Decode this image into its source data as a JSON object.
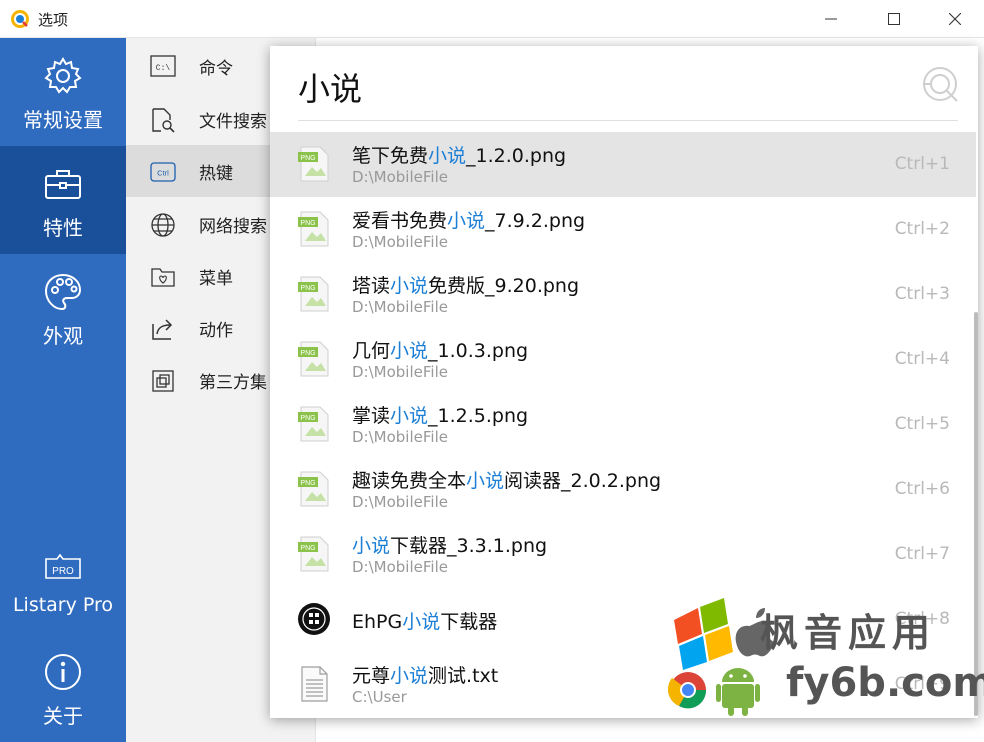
{
  "window": {
    "title": "选项",
    "controls": {
      "minimize": "minimize",
      "maximize": "maximize",
      "close": "close"
    }
  },
  "sidebar": {
    "items": [
      {
        "label": "常规设置",
        "icon": "gear-icon",
        "active": false
      },
      {
        "label": "特性",
        "icon": "toolbox-icon",
        "active": true
      },
      {
        "label": "外观",
        "icon": "palette-icon",
        "active": false
      },
      {
        "label": "Listary Pro",
        "icon": "pro-badge-icon",
        "active": false,
        "badge": "PRO"
      },
      {
        "label": "关于",
        "icon": "info-icon",
        "active": false
      }
    ]
  },
  "midlist": {
    "items": [
      {
        "label": "命令",
        "icon": "command-prompt-icon",
        "icon_text": "C:\\",
        "active": false
      },
      {
        "label": "文件搜索",
        "icon": "file-search-icon",
        "active": false
      },
      {
        "label": "热键",
        "icon": "hotkey-icon",
        "icon_text": "Ctrl",
        "active": true
      },
      {
        "label": "网络搜索",
        "icon": "globe-icon",
        "active": false
      },
      {
        "label": "菜单",
        "icon": "menu-folder-icon",
        "active": false
      },
      {
        "label": "动作",
        "icon": "action-share-icon",
        "active": false
      },
      {
        "label": "第三方集",
        "icon": "integration-icon",
        "active": false
      }
    ]
  },
  "search": {
    "query": "小说",
    "results": [
      {
        "pre": "笔下免费",
        "hl": "小说",
        "post": "_1.2.0.png",
        "path": "D:\\MobileFile",
        "key": "Ctrl+1",
        "type": "png",
        "badge": "PNG",
        "active": true
      },
      {
        "pre": "爱看书免费",
        "hl": "小说",
        "post": "_7.9.2.png",
        "path": "D:\\MobileFile",
        "key": "Ctrl+2",
        "type": "png",
        "badge": "PNG",
        "active": false
      },
      {
        "pre": "塔读",
        "hl": "小说",
        "post": "免费版_9.20.png",
        "path": "D:\\MobileFile",
        "key": "Ctrl+3",
        "type": "png",
        "badge": "PNG",
        "active": false
      },
      {
        "pre": "几何",
        "hl": "小说",
        "post": "_1.0.3.png",
        "path": "D:\\MobileFile",
        "key": "Ctrl+4",
        "type": "png",
        "badge": "PNG",
        "active": false
      },
      {
        "pre": "掌读",
        "hl": "小说",
        "post": "_1.2.5.png",
        "path": "D:\\MobileFile",
        "key": "Ctrl+5",
        "type": "png",
        "badge": "PNG",
        "active": false
      },
      {
        "pre": "趣读免费全本",
        "hl": "小说",
        "post": "阅读器_2.0.2.png",
        "path": "D:\\MobileFile",
        "key": "Ctrl+6",
        "type": "png",
        "badge": "PNG",
        "active": false
      },
      {
        "pre": "",
        "hl": "小说",
        "post": "下载器_3.3.1.png",
        "path": "D:\\MobileFile",
        "key": "Ctrl+7",
        "type": "png",
        "badge": "PNG",
        "active": false
      },
      {
        "pre": "EhPG",
        "hl": "小说",
        "post": "下载器",
        "path": "",
        "key": "Ctrl+8",
        "type": "app",
        "active": false
      },
      {
        "pre": "元尊",
        "hl": "小说",
        "post": "测试.txt",
        "path": "C:\\User",
        "key": "Ctrl+9",
        "type": "txt",
        "active": false
      }
    ]
  },
  "watermark": {
    "line1": "枫音应用",
    "line2": "fy6b.com"
  },
  "colors": {
    "sidebar_bg": "#2f6bbf",
    "sidebar_active": "#1a4f99",
    "highlight": "#1c7fd6",
    "hotkey_text": "#b9b9b9"
  }
}
